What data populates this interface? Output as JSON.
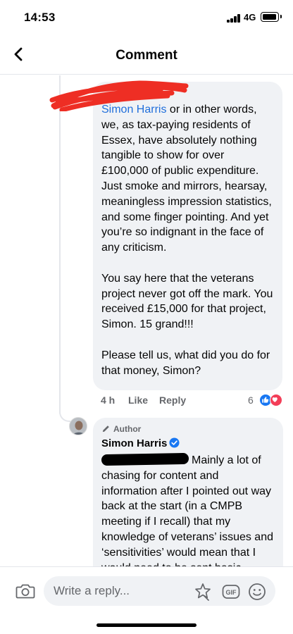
{
  "status_bar": {
    "time": "14:53",
    "network": "4G"
  },
  "header": {
    "title": "Comment"
  },
  "comment": {
    "mention": "Simon Harris",
    "paragraphs": [
      " or in other words, we, as tax-paying residents of Essex, have absolutely nothing tangible to show for over £100,000 of public expenditure. Just smoke and mirrors, hearsay, meaningless impression statistics, and some finger pointing. And yet you’re so indignant in the face of any criticism.",
      "You say here that the veterans project never got off the mark. You received £15,000 for that project, Simon. 15 grand!!!",
      "Please tell us, what did you do for that money, Simon?"
    ],
    "time": "4 h",
    "like_label": "Like",
    "reply_label": "Reply",
    "reaction_count": "6"
  },
  "reply": {
    "author_label": "Author",
    "name": "Simon Harris",
    "text": "Mainly a lot of chasing for content and information after I pointed out way back at the start (in a CMPB meeting if I recall) that my knowledge of veterans’ issues and ‘sensitivities’ would mean that I would need to be sent basic"
  },
  "composer": {
    "placeholder": "Write a reply...",
    "gif_label": "GIF"
  },
  "colors": {
    "mention": "#216fdb",
    "bubble": "#f0f2f5",
    "like": "#1877f2",
    "love": "#f33e58",
    "scribble": "#ee2e24"
  }
}
